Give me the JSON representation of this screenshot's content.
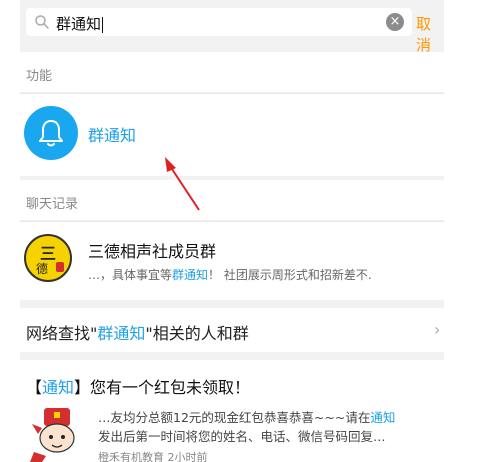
{
  "search": {
    "query": "群通知",
    "clear_icon": "clear-icon",
    "cancel_label": "取消"
  },
  "features": {
    "section_title": "功能",
    "item_label": "群通知",
    "item_icon": "bell-icon",
    "accent": "#19a8f0"
  },
  "chat_history": {
    "section_title": "聊天记录",
    "group_name": "三德相声社成员群",
    "avatar_glyph": "三",
    "avatar_sub": "德",
    "snippet_before": "…，具体事宜等",
    "snippet_highlight": "群通知",
    "snippet_after": "！ 社团展示周形式和招新差不."
  },
  "web_search": {
    "prefix": "网络查找\"",
    "highlight": "群通知",
    "suffix": "\"相关的人和群",
    "chevron": "›"
  },
  "news": {
    "title_open": "【",
    "title_highlight": "通知",
    "title_rest": "】您有一个红包未领取！",
    "line1_before": "…友均分总额12元的现金红包恭喜恭喜~~~请在",
    "line1_highlight": "通知",
    "line2": "发出后第一时间将您的姓名、电话、微信号码回复…",
    "meta": "橙禾有机教育 2小时前"
  },
  "colors": {
    "highlight": "#1ea1e6",
    "cancel": "#ff9800",
    "annotation_arrow": "#e02020"
  }
}
